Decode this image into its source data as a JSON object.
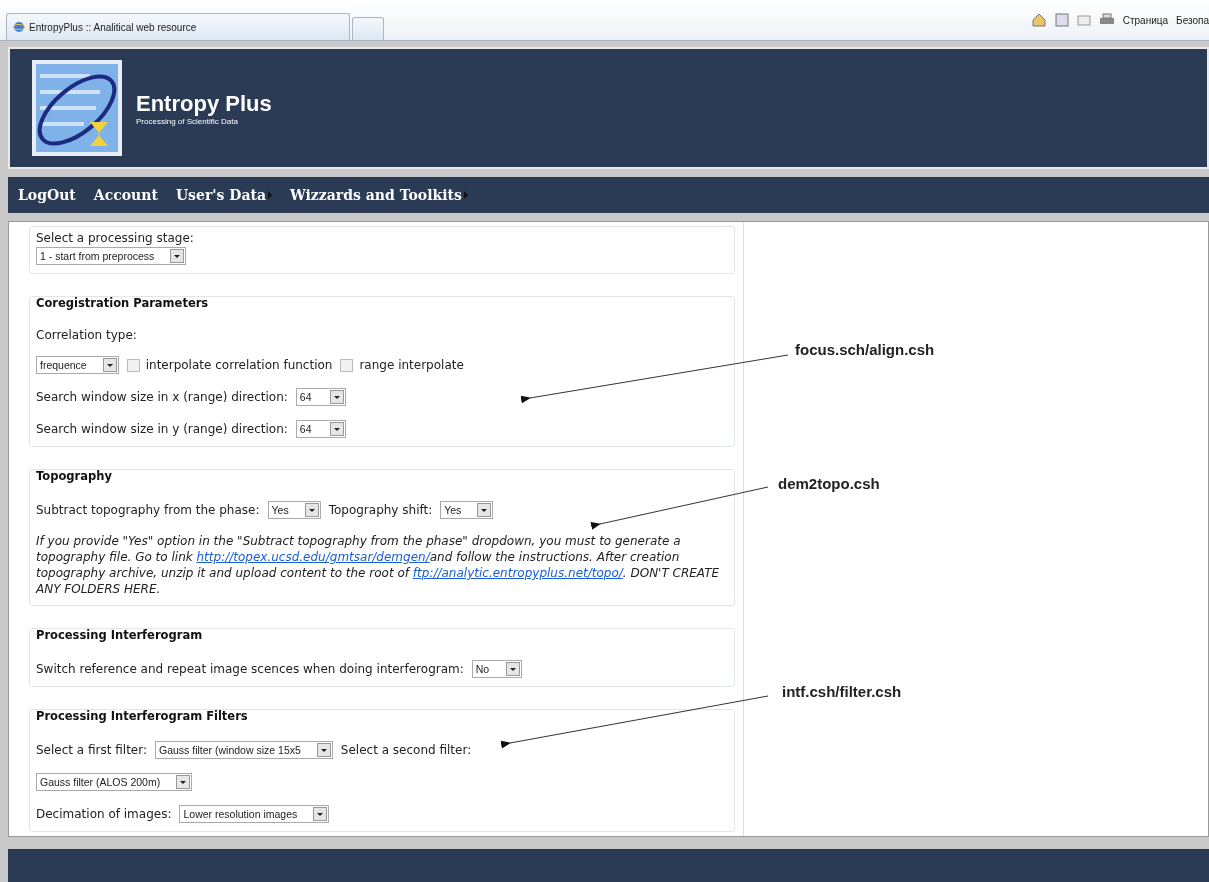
{
  "browser": {
    "tab_title": "EntropyPlus :: Analitical web resource",
    "toolbar": [
      {
        "kind": "home"
      },
      {
        "kind": "feed"
      },
      {
        "kind": "mail"
      },
      {
        "kind": "print"
      },
      {
        "kind": "text",
        "label": "Страница"
      },
      {
        "kind": "text",
        "label": "Безопа"
      }
    ]
  },
  "header": {
    "title": "Entropy Plus",
    "subtitle": "Processing of Scientific Data"
  },
  "nav": [
    {
      "label": "LogOut",
      "submenu": false
    },
    {
      "label": "Account",
      "submenu": false
    },
    {
      "label": "User's Data",
      "submenu": true
    },
    {
      "label": "Wizzards and Toolkits",
      "submenu": true
    }
  ],
  "sections": [
    {
      "rows": [
        [
          {
            "kind": "label",
            "text": "Select a processing stage:"
          }
        ],
        [
          {
            "kind": "select",
            "value": "1 - start from preprocess"
          }
        ]
      ]
    },
    {
      "title": "Coregistration Parameters",
      "rows": [
        [
          {
            "kind": "label",
            "text": "Correlation type:"
          }
        ],
        [
          {
            "kind": "select",
            "value": "frequence"
          },
          {
            "kind": "checkbox",
            "text": "interpolate correlation function",
            "checked": false
          },
          {
            "kind": "checkbox",
            "text": "range interpolate",
            "checked": false
          }
        ],
        [
          {
            "kind": "label",
            "text": "Search window size in x (range) direction:"
          },
          {
            "kind": "select",
            "value": "64"
          }
        ],
        [
          {
            "kind": "label",
            "text": "Search window size in y (range) direction:"
          },
          {
            "kind": "select",
            "value": "64"
          }
        ]
      ]
    },
    {
      "title": "Topography",
      "rows": [
        [
          {
            "kind": "label",
            "text": "Subtract topography from the phase:"
          },
          {
            "kind": "select",
            "value": "Yes"
          },
          {
            "kind": "label",
            "text": "Topography shift:"
          },
          {
            "kind": "select",
            "value": "Yes"
          }
        ],
        [
          {
            "kind": "note",
            "parts": [
              {
                "kind": "text",
                "text": "If you provide \"Yes\" option in the \"Subtract topography from the phase\" dropdown, you must to generate a topography file. Go to link "
              },
              {
                "kind": "link",
                "text": "http://topex.ucsd.edu/gmtsar/demgen/"
              },
              {
                "kind": "text",
                "text": "and follow the instructions. After creation topography archive, unzip it and upload content to the root of "
              },
              {
                "kind": "link",
                "text": "ftp://analytic.entropyplus.net/topo/"
              },
              {
                "kind": "text",
                "text": ". DON'T CREATE ANY FOLDERS HERE."
              }
            ]
          }
        ]
      ]
    },
    {
      "title": "Processing Interferogram",
      "rows": [
        [
          {
            "kind": "label",
            "text": "Switch reference and repeat image scences when doing interferogram:"
          },
          {
            "kind": "select",
            "value": "No"
          }
        ]
      ]
    },
    {
      "title": "Processing Interferogram Filters",
      "rows": [
        [
          {
            "kind": "label",
            "text": "Select a first filter:"
          },
          {
            "kind": "select",
            "value": "Gauss filter (window size 15x5"
          },
          {
            "kind": "label",
            "text": "Select a second filter:"
          }
        ],
        [
          {
            "kind": "select",
            "value": "Gauss filter (ALOS 200m)"
          }
        ],
        [
          {
            "kind": "label",
            "text": "Decimation of images:"
          },
          {
            "kind": "select",
            "value": "Lower resolution images"
          }
        ]
      ]
    }
  ],
  "annotations": [
    {
      "label": "focus.sch/align.csh"
    },
    {
      "label": "dem2topo.csh"
    },
    {
      "label": "intf.csh/filter.csh"
    }
  ]
}
